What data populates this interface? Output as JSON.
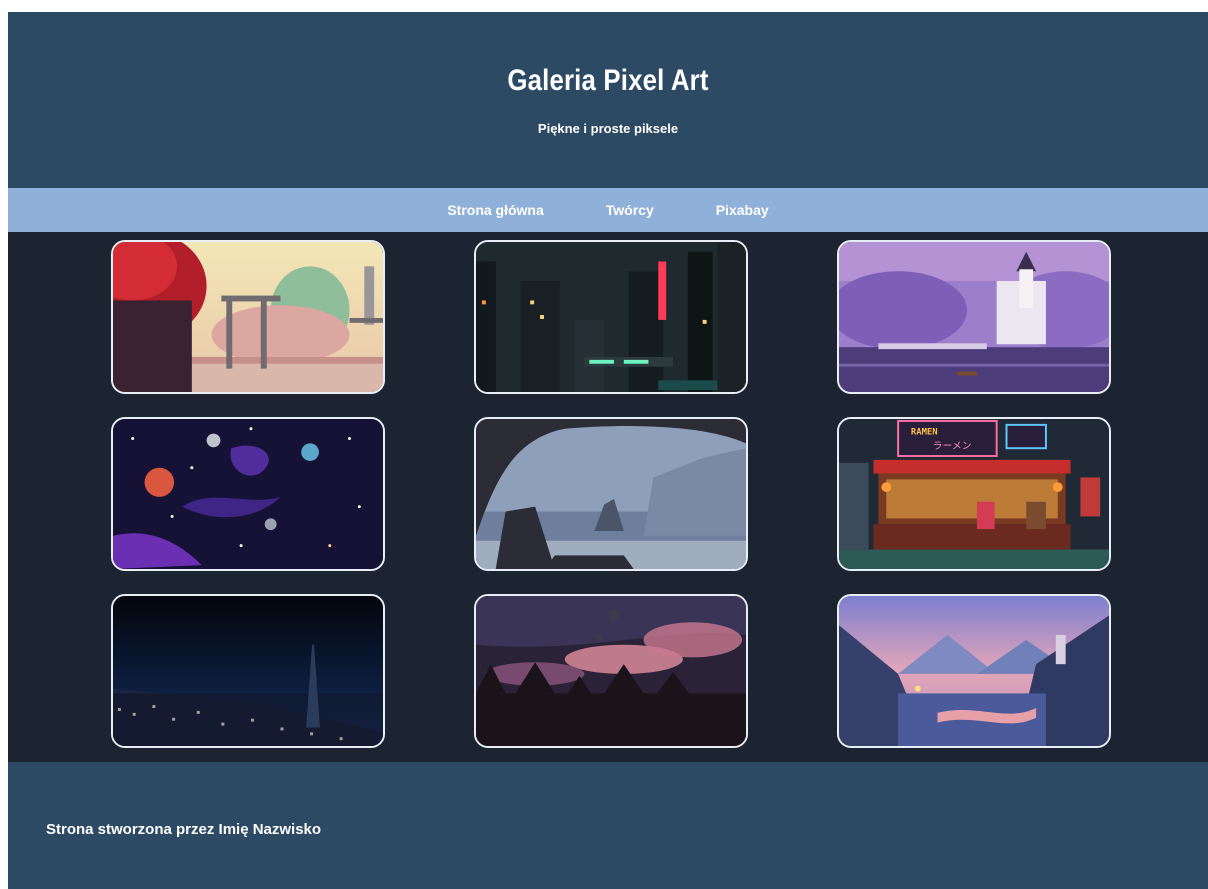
{
  "header": {
    "title": "Galeria Pixel Art",
    "subtitle": "Piękne i proste piksele"
  },
  "nav": {
    "items": [
      "Strona główna",
      "Twórcy",
      "Pixabay"
    ]
  },
  "gallery": {
    "images": [
      {
        "name": "forest-ruins-image"
      },
      {
        "name": "cyberpunk-city-image"
      },
      {
        "name": "castle-lake-image"
      },
      {
        "name": "space-nebula-image"
      },
      {
        "name": "sea-cave-image"
      },
      {
        "name": "ramen-shop-image"
      },
      {
        "name": "night-city-image"
      },
      {
        "name": "night-sky-forest-image"
      },
      {
        "name": "mountain-valley-image"
      }
    ],
    "ramen_sign": "RAMEN",
    "ramen_kana": "ラーメン"
  },
  "footer": {
    "text": "Strona stworzona przez Imię Nazwisko"
  },
  "colors": {
    "header_bg": "#2c4a63",
    "nav_bg": "#8fb0d8",
    "gallery_bg": "#1b2430"
  }
}
